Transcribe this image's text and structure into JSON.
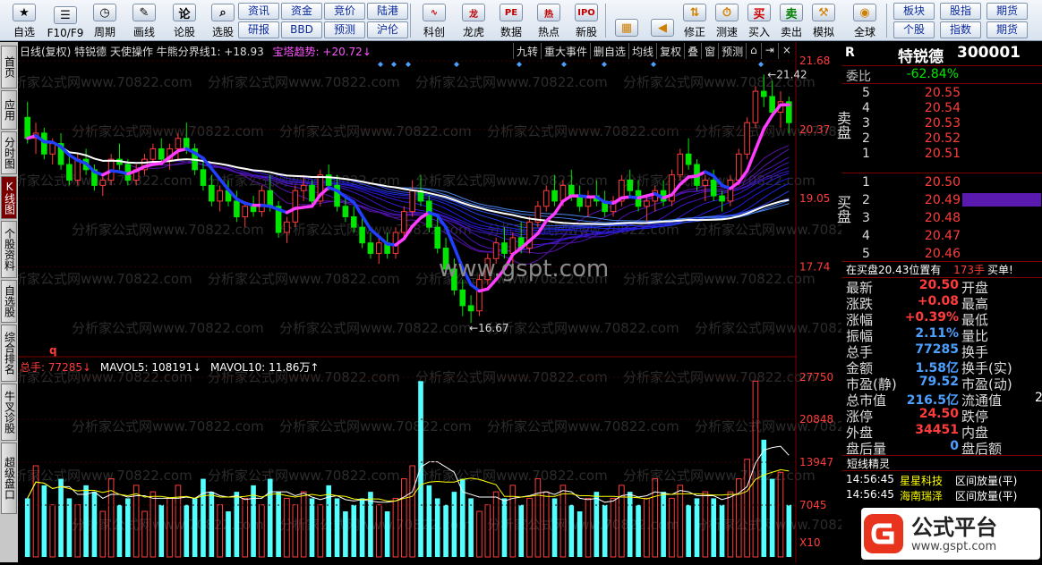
{
  "toolbar": {
    "big_buttons": [
      {
        "label": "自选",
        "icon": "star-icon"
      },
      {
        "label": "F10/F9",
        "icon": "list-icon"
      },
      {
        "label": "周期",
        "icon": "clock-icon"
      },
      {
        "label": "画线",
        "icon": "pencil-icon"
      },
      {
        "label": "论股",
        "icon": "discuss-icon"
      },
      {
        "label": "选股",
        "icon": "magnifier-chart-icon"
      }
    ],
    "small_top": [
      "资讯",
      "资金",
      "竞价",
      "陆港"
    ],
    "small_bottom": [
      "研报",
      "BBD",
      "预测",
      "沪伦"
    ],
    "mid_buttons": [
      {
        "label": "科创",
        "icon": "chart-icon"
      },
      {
        "label": "龙虎",
        "icon": "dragon-icon"
      },
      {
        "label": "数据",
        "icon": "pe-icon"
      },
      {
        "label": "热点",
        "icon": "hot-icon"
      },
      {
        "label": "新股",
        "icon": "ipo-icon"
      }
    ],
    "nav_buttons": [
      {
        "label": "",
        "icon": "grid-icon"
      },
      {
        "label": "",
        "icon": "back-arrow-icon"
      },
      {
        "label": "修正",
        "icon": "updown-arrows-icon"
      },
      {
        "label": "测速",
        "icon": "stopwatch-icon"
      },
      {
        "label": "买入",
        "icon": "buy-icon"
      },
      {
        "label": "卖出",
        "icon": "sell-icon"
      },
      {
        "label": "模拟",
        "icon": "hammer-icon"
      },
      {
        "label": "全球",
        "icon": "globe-icon"
      }
    ],
    "right_top": [
      "板块",
      "股指",
      "期货"
    ],
    "right_bottom": [
      "个股",
      "指数",
      "期货"
    ]
  },
  "left_tabs": [
    "首页",
    "应用",
    "分时图",
    "K线图",
    "个股资料",
    "自选股",
    "综合排名",
    "牛叉诊股",
    "超级盘口"
  ],
  "chart_header": {
    "title": "日线(复权)  特锐德  天使操作  牛熊分界线1: +18.93",
    "trend": "宝塔趋势: +20.72↓",
    "buttons": [
      "九转",
      "重大事件",
      "删自选",
      "均线",
      "复权",
      "叠",
      "窗",
      "预测"
    ],
    "price_labels": [
      "21.68",
      "20.37",
      "19.05",
      "17.74"
    ],
    "high_mark": "21.42",
    "low_mark": "16.67",
    "watermark": "www.gspt.com",
    "bg_text": "分析家公式网www.70822.com",
    "q_label": "q"
  },
  "volume_header": {
    "prefix": "总手: 77285↓",
    "ma5": "MAVOL5: 108191↓",
    "ma10": "MAVOL10: 11.86万↑",
    "vol_labels": [
      "27750",
      "20848",
      "13947",
      "7045"
    ],
    "unit": "X10"
  },
  "colors": {
    "up": "#ff3c3c",
    "down": "#00e600",
    "volume_bar": "#54ffff",
    "accent": "#ffff00"
  },
  "quote": {
    "code": "300001",
    "name": "特锐德",
    "prefix": "R",
    "weibi_label": "委比",
    "weibi": "-62.84%",
    "sell": [
      [
        "5",
        "20.55"
      ],
      [
        "4",
        "20.54"
      ],
      [
        "3",
        "20.53"
      ],
      [
        "2",
        "20.52"
      ],
      [
        "1",
        "20.51"
      ]
    ],
    "buy": [
      [
        "1",
        "20.50"
      ],
      [
        "2",
        "20.49"
      ],
      [
        "3",
        "20.48"
      ],
      [
        "4",
        "20.47"
      ],
      [
        "5",
        "20.46"
      ]
    ],
    "sell_side": "卖盘",
    "buy_side": "买盘",
    "order_line": "在买盘20.43位置有",
    "order_qty": "173手",
    "order_tag": "买单!",
    "stats": [
      {
        "l": "最新",
        "v": "20.50",
        "r": "开盘"
      },
      {
        "l": "涨跌",
        "v": "+0.08",
        "r": "最高"
      },
      {
        "l": "涨幅",
        "v": "+0.39%",
        "r": "最低"
      },
      {
        "l": "振幅",
        "v": "2.11%",
        "r": "量比"
      },
      {
        "l": "总手",
        "v": "77285",
        "r": "换手"
      },
      {
        "l": "金额",
        "v": "1.58亿",
        "r": "换手(实)"
      },
      {
        "l": "市盈(静)",
        "v": "79.52",
        "r": "市盈(动)"
      },
      {
        "l": "总市值",
        "v": "216.5亿",
        "r": "流通值"
      },
      {
        "l": "涨停",
        "v": "24.50",
        "r": "跌停"
      },
      {
        "l": "外盘",
        "v": "34451",
        "r": "内盘"
      },
      {
        "l": "盘后量",
        "v": "0",
        "r": "盘后额"
      }
    ],
    "stat_right_cut": "2",
    "short_title": "短线精灵",
    "short_list": [
      {
        "t": "14:56:45",
        "n": "星星科技",
        "e": "区间放量(平)"
      },
      {
        "t": "14:56:45",
        "n": "海南瑞泽",
        "e": "区间放量(平)"
      }
    ],
    "brand": "公式平台",
    "brand_url": "www.gspt.com"
  },
  "chart_data": {
    "type": "candlestick",
    "title": "日线(复权) 特锐德",
    "ylim": [
      16.4,
      21.7
    ],
    "series": [
      {
        "name": "K线",
        "ohlc": [
          [
            20.6,
            20.9,
            20.1,
            20.2
          ],
          [
            20.2,
            20.5,
            19.9,
            20.3
          ],
          [
            20.3,
            20.4,
            19.8,
            19.9
          ],
          [
            19.9,
            20.2,
            19.7,
            20.1
          ],
          [
            20.1,
            20.3,
            19.6,
            19.7
          ],
          [
            19.7,
            19.9,
            19.3,
            19.4
          ],
          [
            19.4,
            19.9,
            19.3,
            19.8
          ],
          [
            19.8,
            20.0,
            19.5,
            19.6
          ],
          [
            19.6,
            19.7,
            19.2,
            19.3
          ],
          [
            19.3,
            19.5,
            19.1,
            19.4
          ],
          [
            19.4,
            19.9,
            19.3,
            19.8
          ],
          [
            19.8,
            20.1,
            19.6,
            19.7
          ],
          [
            19.7,
            19.8,
            19.3,
            19.4
          ],
          [
            19.4,
            19.7,
            19.3,
            19.6
          ],
          [
            19.6,
            19.9,
            19.5,
            19.8
          ],
          [
            19.8,
            20.1,
            19.7,
            20.0
          ],
          [
            20.0,
            20.2,
            19.7,
            19.8
          ],
          [
            19.8,
            20.1,
            19.6,
            20.0
          ],
          [
            20.0,
            20.3,
            19.8,
            20.2
          ],
          [
            20.2,
            20.5,
            19.9,
            20.0
          ],
          [
            20.0,
            20.1,
            19.5,
            19.6
          ],
          [
            19.6,
            19.8,
            19.2,
            19.3
          ],
          [
            19.3,
            19.5,
            18.9,
            19.0
          ],
          [
            19.0,
            19.3,
            18.8,
            19.2
          ],
          [
            19.2,
            19.4,
            18.9,
            19.0
          ],
          [
            19.0,
            19.2,
            18.6,
            18.7
          ],
          [
            18.7,
            19.0,
            18.5,
            18.9
          ],
          [
            18.9,
            19.1,
            18.7,
            18.8
          ],
          [
            18.8,
            19.3,
            18.7,
            19.2
          ],
          [
            19.2,
            19.5,
            18.8,
            18.9
          ],
          [
            18.9,
            19.0,
            18.3,
            18.4
          ],
          [
            18.4,
            18.7,
            18.2,
            18.6
          ],
          [
            18.6,
            19.3,
            18.5,
            19.2
          ],
          [
            19.2,
            19.5,
            19.0,
            19.3
          ],
          [
            19.3,
            19.4,
            18.9,
            19.0
          ],
          [
            19.0,
            19.6,
            18.9,
            19.5
          ],
          [
            19.5,
            19.7,
            19.2,
            19.3
          ],
          [
            19.3,
            19.5,
            18.8,
            18.9
          ],
          [
            18.9,
            19.1,
            18.6,
            18.7
          ],
          [
            18.7,
            18.9,
            18.4,
            18.5
          ],
          [
            18.5,
            18.7,
            18.1,
            18.2
          ],
          [
            18.2,
            18.4,
            17.9,
            18.0
          ],
          [
            18.0,
            18.3,
            17.8,
            18.2
          ],
          [
            18.2,
            18.4,
            17.9,
            18.0
          ],
          [
            18.0,
            18.5,
            17.9,
            18.4
          ],
          [
            18.4,
            18.9,
            18.3,
            18.8
          ],
          [
            18.8,
            19.4,
            18.7,
            19.2
          ],
          [
            19.2,
            19.5,
            18.9,
            19.0
          ],
          [
            19.0,
            19.1,
            18.4,
            18.5
          ],
          [
            18.5,
            18.7,
            18.0,
            18.1
          ],
          [
            18.1,
            18.3,
            17.6,
            17.7
          ],
          [
            17.7,
            17.9,
            17.2,
            17.3
          ],
          [
            17.3,
            17.5,
            16.8,
            17.0
          ],
          [
            17.0,
            17.2,
            16.67,
            16.9
          ],
          [
            16.9,
            17.6,
            16.8,
            17.5
          ],
          [
            17.5,
            18.0,
            17.4,
            17.9
          ],
          [
            17.9,
            18.3,
            17.8,
            18.2
          ],
          [
            18.2,
            18.5,
            17.9,
            18.0
          ],
          [
            18.0,
            18.4,
            17.8,
            18.3
          ],
          [
            18.3,
            18.6,
            18.0,
            18.1
          ],
          [
            18.1,
            18.7,
            18.0,
            18.6
          ],
          [
            18.6,
            19.0,
            18.5,
            18.9
          ],
          [
            18.9,
            19.3,
            18.8,
            19.2
          ],
          [
            19.2,
            19.5,
            18.9,
            19.0
          ],
          [
            19.0,
            19.4,
            18.9,
            19.3
          ],
          [
            19.3,
            19.6,
            19.0,
            19.1
          ],
          [
            19.1,
            19.3,
            18.8,
            18.9
          ],
          [
            18.9,
            19.2,
            18.7,
            19.1
          ],
          [
            19.1,
            19.4,
            18.9,
            19.0
          ],
          [
            19.0,
            19.2,
            18.7,
            18.8
          ],
          [
            18.8,
            19.1,
            18.7,
            19.0
          ],
          [
            19.0,
            19.5,
            18.9,
            19.4
          ],
          [
            19.4,
            19.6,
            19.1,
            19.2
          ],
          [
            19.2,
            19.4,
            18.8,
            18.9
          ],
          [
            18.9,
            19.1,
            18.6,
            19.0
          ],
          [
            19.0,
            19.3,
            18.8,
            19.2
          ],
          [
            19.2,
            19.4,
            18.9,
            19.0
          ],
          [
            19.0,
            19.6,
            18.9,
            19.5
          ],
          [
            19.5,
            20.0,
            19.4,
            19.9
          ],
          [
            19.9,
            20.2,
            19.6,
            19.7
          ],
          [
            19.7,
            19.8,
            19.2,
            19.3
          ],
          [
            19.3,
            19.5,
            19.0,
            19.4
          ],
          [
            19.4,
            19.6,
            19.0,
            19.1
          ],
          [
            19.1,
            19.2,
            18.8,
            19.0
          ],
          [
            19.0,
            19.5,
            18.9,
            19.4
          ],
          [
            19.4,
            20.0,
            19.3,
            19.9
          ],
          [
            19.9,
            20.6,
            19.8,
            20.5
          ],
          [
            20.5,
            21.2,
            20.4,
            21.1
          ],
          [
            21.1,
            21.42,
            20.8,
            21.0
          ],
          [
            21.0,
            21.3,
            20.6,
            20.7
          ],
          [
            20.7,
            21.1,
            20.4,
            20.9
          ],
          [
            20.9,
            21.0,
            20.3,
            20.5
          ]
        ]
      }
    ],
    "volume": [
      9,
      14,
      11,
      8,
      12,
      9,
      8,
      11,
      10,
      7,
      12,
      8,
      9,
      11,
      7,
      10,
      8,
      9,
      11,
      8,
      9,
      12,
      10,
      8,
      7,
      10,
      9,
      11,
      8,
      12,
      10,
      9,
      8,
      10,
      9,
      8,
      11,
      9,
      7,
      8,
      9,
      10,
      8,
      7,
      9,
      12,
      14,
      27,
      11,
      9,
      8,
      10,
      12,
      9,
      7,
      8,
      10,
      9,
      11,
      8,
      9,
      12,
      10,
      9,
      11,
      8,
      7,
      9,
      10,
      8,
      9,
      11,
      10,
      8,
      9,
      12,
      10,
      9,
      11,
      8,
      9,
      10,
      9,
      8,
      10,
      12,
      15,
      27,
      18,
      12,
      13,
      8
    ]
  }
}
